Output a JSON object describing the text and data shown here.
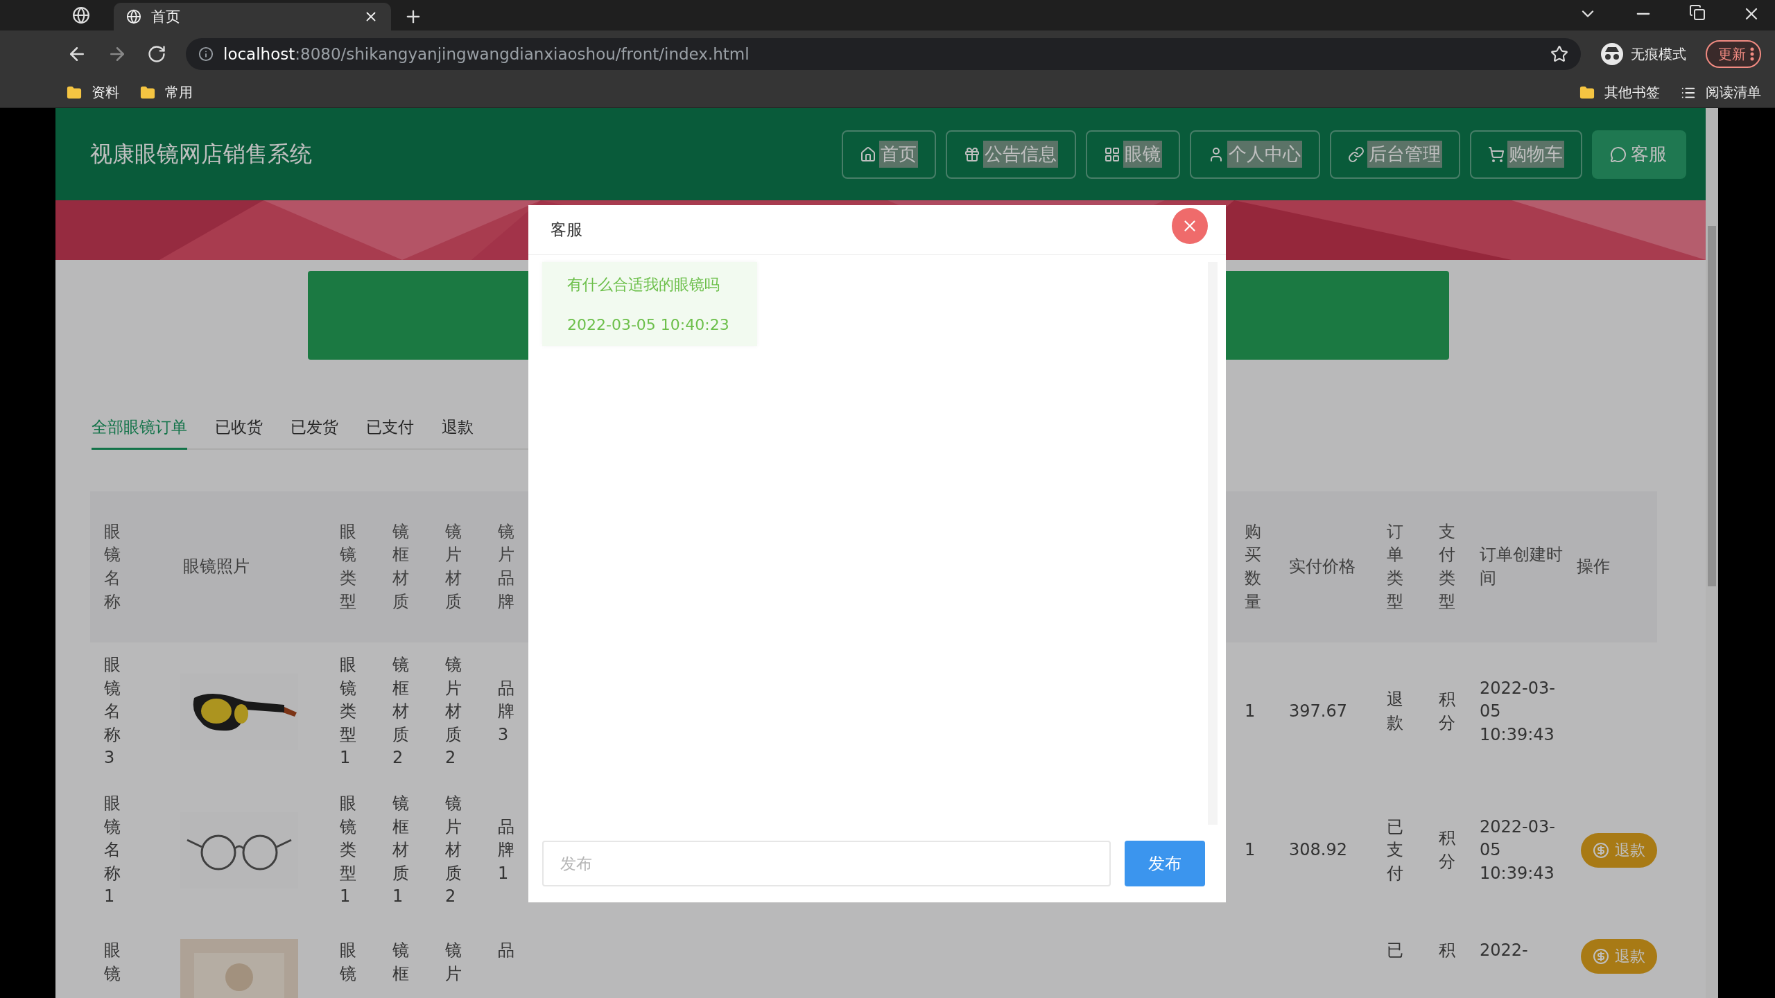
{
  "browser": {
    "tabs": [
      {
        "title": "首页",
        "selected": true
      }
    ],
    "url_host": "localhost",
    "url_path": ":8080/shikangyanjingwangdianxiaoshou/front/index.html",
    "bookmarks": [
      "资料",
      "常用"
    ],
    "other_bookmarks": "其他书签",
    "reading_list": "阅读清单",
    "incognito": "无痕模式",
    "update": "更新"
  },
  "site": {
    "title": "视康眼镜网店销售系统",
    "nav": [
      {
        "label": "首页",
        "selected": false
      },
      {
        "label": "公告信息",
        "selected": false
      },
      {
        "label": "眼镜",
        "selected": false
      },
      {
        "label": "个人中心",
        "selected": false
      },
      {
        "label": "后台管理",
        "selected": false
      },
      {
        "label": "购物车",
        "selected": false
      },
      {
        "label": "客服",
        "selected": true
      }
    ]
  },
  "order_tabs": [
    {
      "label": "全部眼镜订单",
      "selected": true
    },
    {
      "label": "已收货",
      "selected": false
    },
    {
      "label": "已发货",
      "selected": false
    },
    {
      "label": "已支付",
      "selected": false
    },
    {
      "label": "退款",
      "selected": false
    }
  ],
  "table": {
    "columns_left": [
      "眼镜名称",
      "眼镜照片",
      "眼镜类型",
      "镜框材质",
      "镜片材质",
      "镜片品牌"
    ],
    "columns_right": [
      "购买数量",
      "实付价格",
      "订单类型",
      "支付类型",
      "订单创建时间",
      "操作"
    ],
    "rows": [
      {
        "name": "眼镜名称3",
        "type": "眼镜类型1",
        "frame": "镜框材质2",
        "lens": "镜片材质2",
        "brand": "品牌3",
        "qty": "1",
        "price": "397.67",
        "order_type": "退款",
        "pay_type": "积分",
        "created": "2022-03-05 10:39:43"
      },
      {
        "name": "眼镜名称1",
        "type": "眼镜类型1",
        "frame": "镜框材质1",
        "lens": "镜片材质2",
        "brand": "品牌1",
        "qty": "1",
        "price": "308.92",
        "order_type": "已支付",
        "pay_type": "积分",
        "created": "2022-03-05 10:39:43",
        "action": "退款"
      },
      {
        "name": "眼镜",
        "type": "眼镜",
        "frame": "镜框",
        "lens": "镜片",
        "brand": "品",
        "order_type": "已",
        "pay_type": "积",
        "created": "2022-",
        "action": "退款"
      }
    ]
  },
  "modal": {
    "title": "客服",
    "messages": [
      {
        "text": "有什么合适我的眼镜吗",
        "time": "2022-03-05 10:40:23"
      }
    ],
    "input": {
      "placeholder": "发布"
    },
    "send": "发布"
  }
}
